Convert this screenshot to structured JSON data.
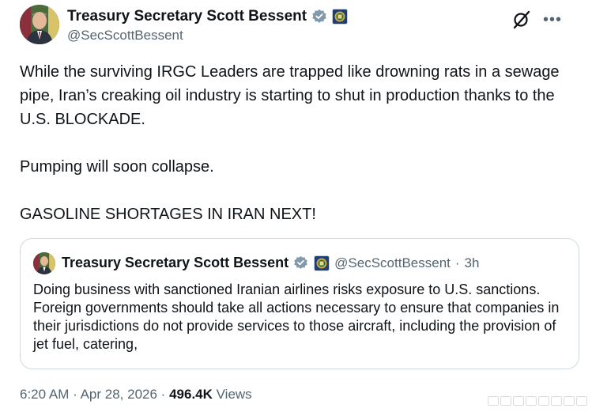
{
  "author": {
    "display_name": "Treasury Secretary Scott Bessent",
    "handle": "@SecScottBessent"
  },
  "post": {
    "paragraphs": [
      "While the surviving IRGC Leaders are trapped like drowning rats in a sewage pipe, Iran’s creaking oil industry is starting to shut in production thanks to the U.S. BLOCKADE.",
      "Pumping will soon collapse.",
      "GASOLINE SHORTAGES IN IRAN NEXT!"
    ]
  },
  "quoted": {
    "display_name": "Treasury Secretary Scott Bessent",
    "handle": "@SecScottBessent",
    "separator": "·",
    "time": "3h",
    "text": "Doing business with sanctioned Iranian airlines risks exposure to U.S. sanctions.  Foreign governments should take all actions necessary to ensure that companies in their jurisdictions do not provide services to those aircraft, including the provision of jet fuel, catering,"
  },
  "meta": {
    "time": "6:20 AM",
    "dot1": "·",
    "date": "Apr 28, 2026",
    "dot2": "·",
    "views_count": "496.4K",
    "views_label": "Views"
  },
  "colors": {
    "verified": "#829aab",
    "secondary_text": "#536471",
    "primary_text": "#0f1419",
    "border": "#cfd9de"
  },
  "icons": [
    "grok-icon",
    "more-icon",
    "verified-badge-icon",
    "treasury-seal-icon"
  ]
}
